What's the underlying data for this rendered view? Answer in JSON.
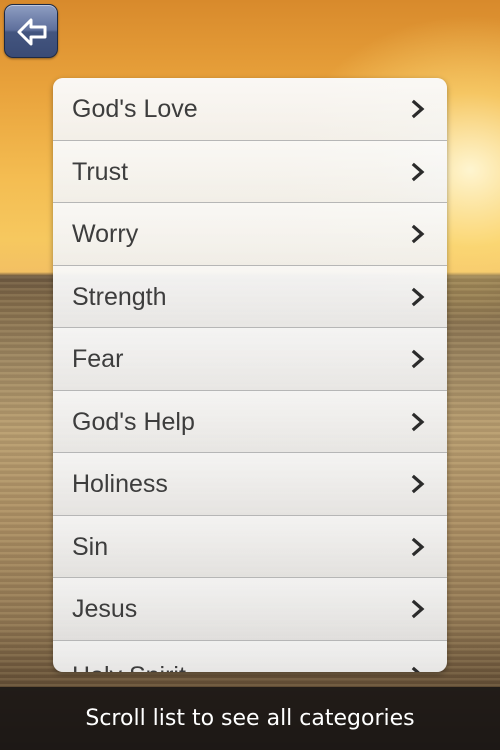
{
  "navigation": {
    "back_icon": "arrow-left-icon"
  },
  "categories": {
    "items": [
      {
        "label": "God's Love"
      },
      {
        "label": "Trust"
      },
      {
        "label": "Worry"
      },
      {
        "label": "Strength"
      },
      {
        "label": "Fear"
      },
      {
        "label": "God's Help"
      },
      {
        "label": "Holiness"
      },
      {
        "label": "Sin"
      },
      {
        "label": "Jesus"
      },
      {
        "label": "Holy Spirit"
      }
    ]
  },
  "footer": {
    "hint": "Scroll list to see all categories"
  },
  "colors": {
    "back_button": "#4a5b86",
    "list_text": "#3d3d3d",
    "footer_bg": "#1c1816"
  }
}
